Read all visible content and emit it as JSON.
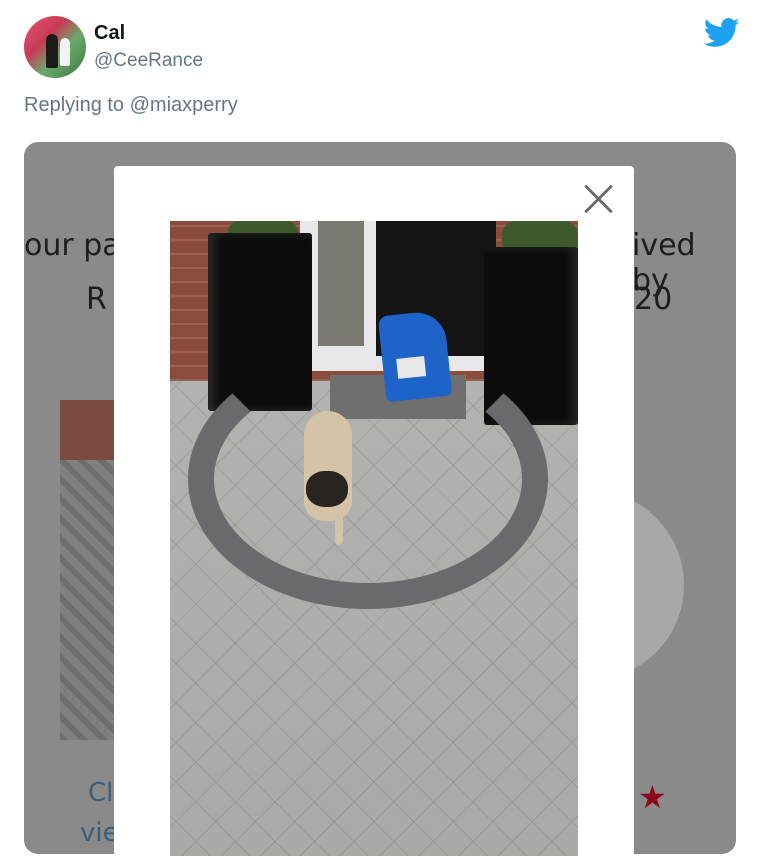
{
  "tweet": {
    "name": "Cal",
    "handle": "@CeeRance",
    "reply_text": "Replying to @miaxperry"
  },
  "background_card": {
    "line1_left": "our pa",
    "line1_right": "ived by",
    "line2_left": "R",
    "line2_right": "20",
    "footer_left_1": "Cl",
    "footer_left_2": "vie",
    "star": "★"
  },
  "modal": {
    "close_glyph": "",
    "photo_alt": "pug-on-driveway-photo"
  },
  "colors": {
    "twitter_blue": "#1da1f2",
    "handle_gray": "#657786",
    "overlay_gray": "#8a8a8a",
    "star_red": "#8b0a1e"
  },
  "icons": {
    "twitter": "twitter-bird-icon",
    "close": "close-icon"
  }
}
